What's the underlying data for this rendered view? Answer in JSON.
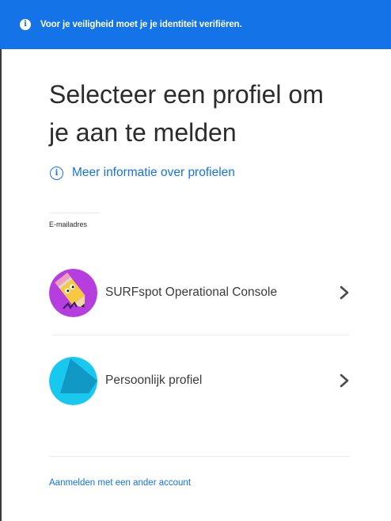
{
  "banner": {
    "icon": "info-icon",
    "text": "Voor je veiligheid moet je je identiteit verifiëren.",
    "color": "#1473e6"
  },
  "page": {
    "title_line1": "Selecteer een profiel om",
    "title_line2": "je aan te melden"
  },
  "info_link": {
    "icon": "info-circle-icon",
    "label": "Meer informatie over profielen"
  },
  "email": {
    "label": "E-mailadres",
    "value": ""
  },
  "profiles": [
    {
      "name": "SURFspot Operational Console",
      "avatar": "pencil-avatar-icon",
      "avatar_color": "#b63dde"
    },
    {
      "name": "Persoonlijk profiel",
      "avatar": "personal-profile-avatar-icon",
      "avatar_color": "#19c8ee"
    }
  ],
  "footer": {
    "other_account_label": "Aanmelden met een ander account"
  },
  "colors": {
    "accent": "#1473e6",
    "text": "#2c2c2c"
  }
}
